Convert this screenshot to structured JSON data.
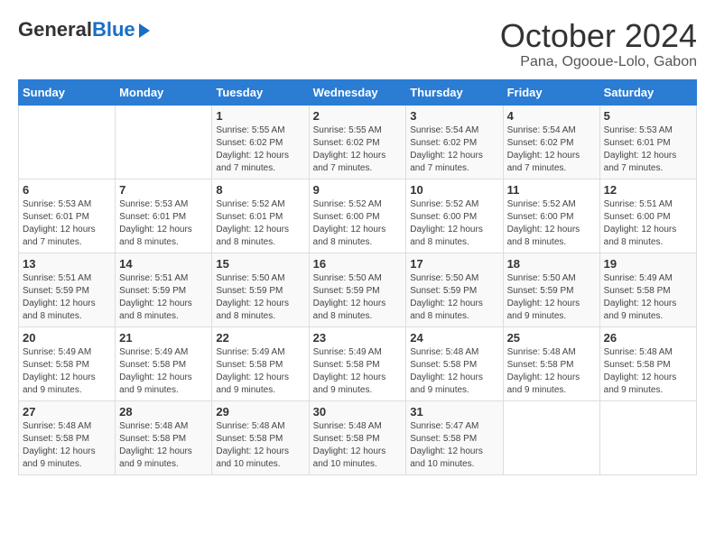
{
  "header": {
    "logo_general": "General",
    "logo_blue": "Blue",
    "title": "October 2024",
    "subtitle": "Pana, Ogooue-Lolo, Gabon"
  },
  "columns": [
    "Sunday",
    "Monday",
    "Tuesday",
    "Wednesday",
    "Thursday",
    "Friday",
    "Saturday"
  ],
  "weeks": [
    [
      {
        "day": "",
        "sunrise": "",
        "sunset": "",
        "daylight": ""
      },
      {
        "day": "",
        "sunrise": "",
        "sunset": "",
        "daylight": ""
      },
      {
        "day": "1",
        "sunrise": "Sunrise: 5:55 AM",
        "sunset": "Sunset: 6:02 PM",
        "daylight": "Daylight: 12 hours and 7 minutes."
      },
      {
        "day": "2",
        "sunrise": "Sunrise: 5:55 AM",
        "sunset": "Sunset: 6:02 PM",
        "daylight": "Daylight: 12 hours and 7 minutes."
      },
      {
        "day": "3",
        "sunrise": "Sunrise: 5:54 AM",
        "sunset": "Sunset: 6:02 PM",
        "daylight": "Daylight: 12 hours and 7 minutes."
      },
      {
        "day": "4",
        "sunrise": "Sunrise: 5:54 AM",
        "sunset": "Sunset: 6:02 PM",
        "daylight": "Daylight: 12 hours and 7 minutes."
      },
      {
        "day": "5",
        "sunrise": "Sunrise: 5:53 AM",
        "sunset": "Sunset: 6:01 PM",
        "daylight": "Daylight: 12 hours and 7 minutes."
      }
    ],
    [
      {
        "day": "6",
        "sunrise": "Sunrise: 5:53 AM",
        "sunset": "Sunset: 6:01 PM",
        "daylight": "Daylight: 12 hours and 7 minutes."
      },
      {
        "day": "7",
        "sunrise": "Sunrise: 5:53 AM",
        "sunset": "Sunset: 6:01 PM",
        "daylight": "Daylight: 12 hours and 8 minutes."
      },
      {
        "day": "8",
        "sunrise": "Sunrise: 5:52 AM",
        "sunset": "Sunset: 6:01 PM",
        "daylight": "Daylight: 12 hours and 8 minutes."
      },
      {
        "day": "9",
        "sunrise": "Sunrise: 5:52 AM",
        "sunset": "Sunset: 6:00 PM",
        "daylight": "Daylight: 12 hours and 8 minutes."
      },
      {
        "day": "10",
        "sunrise": "Sunrise: 5:52 AM",
        "sunset": "Sunset: 6:00 PM",
        "daylight": "Daylight: 12 hours and 8 minutes."
      },
      {
        "day": "11",
        "sunrise": "Sunrise: 5:52 AM",
        "sunset": "Sunset: 6:00 PM",
        "daylight": "Daylight: 12 hours and 8 minutes."
      },
      {
        "day": "12",
        "sunrise": "Sunrise: 5:51 AM",
        "sunset": "Sunset: 6:00 PM",
        "daylight": "Daylight: 12 hours and 8 minutes."
      }
    ],
    [
      {
        "day": "13",
        "sunrise": "Sunrise: 5:51 AM",
        "sunset": "Sunset: 5:59 PM",
        "daylight": "Daylight: 12 hours and 8 minutes."
      },
      {
        "day": "14",
        "sunrise": "Sunrise: 5:51 AM",
        "sunset": "Sunset: 5:59 PM",
        "daylight": "Daylight: 12 hours and 8 minutes."
      },
      {
        "day": "15",
        "sunrise": "Sunrise: 5:50 AM",
        "sunset": "Sunset: 5:59 PM",
        "daylight": "Daylight: 12 hours and 8 minutes."
      },
      {
        "day": "16",
        "sunrise": "Sunrise: 5:50 AM",
        "sunset": "Sunset: 5:59 PM",
        "daylight": "Daylight: 12 hours and 8 minutes."
      },
      {
        "day": "17",
        "sunrise": "Sunrise: 5:50 AM",
        "sunset": "Sunset: 5:59 PM",
        "daylight": "Daylight: 12 hours and 8 minutes."
      },
      {
        "day": "18",
        "sunrise": "Sunrise: 5:50 AM",
        "sunset": "Sunset: 5:59 PM",
        "daylight": "Daylight: 12 hours and 9 minutes."
      },
      {
        "day": "19",
        "sunrise": "Sunrise: 5:49 AM",
        "sunset": "Sunset: 5:58 PM",
        "daylight": "Daylight: 12 hours and 9 minutes."
      }
    ],
    [
      {
        "day": "20",
        "sunrise": "Sunrise: 5:49 AM",
        "sunset": "Sunset: 5:58 PM",
        "daylight": "Daylight: 12 hours and 9 minutes."
      },
      {
        "day": "21",
        "sunrise": "Sunrise: 5:49 AM",
        "sunset": "Sunset: 5:58 PM",
        "daylight": "Daylight: 12 hours and 9 minutes."
      },
      {
        "day": "22",
        "sunrise": "Sunrise: 5:49 AM",
        "sunset": "Sunset: 5:58 PM",
        "daylight": "Daylight: 12 hours and 9 minutes."
      },
      {
        "day": "23",
        "sunrise": "Sunrise: 5:49 AM",
        "sunset": "Sunset: 5:58 PM",
        "daylight": "Daylight: 12 hours and 9 minutes."
      },
      {
        "day": "24",
        "sunrise": "Sunrise: 5:48 AM",
        "sunset": "Sunset: 5:58 PM",
        "daylight": "Daylight: 12 hours and 9 minutes."
      },
      {
        "day": "25",
        "sunrise": "Sunrise: 5:48 AM",
        "sunset": "Sunset: 5:58 PM",
        "daylight": "Daylight: 12 hours and 9 minutes."
      },
      {
        "day": "26",
        "sunrise": "Sunrise: 5:48 AM",
        "sunset": "Sunset: 5:58 PM",
        "daylight": "Daylight: 12 hours and 9 minutes."
      }
    ],
    [
      {
        "day": "27",
        "sunrise": "Sunrise: 5:48 AM",
        "sunset": "Sunset: 5:58 PM",
        "daylight": "Daylight: 12 hours and 9 minutes."
      },
      {
        "day": "28",
        "sunrise": "Sunrise: 5:48 AM",
        "sunset": "Sunset: 5:58 PM",
        "daylight": "Daylight: 12 hours and 9 minutes."
      },
      {
        "day": "29",
        "sunrise": "Sunrise: 5:48 AM",
        "sunset": "Sunset: 5:58 PM",
        "daylight": "Daylight: 12 hours and 10 minutes."
      },
      {
        "day": "30",
        "sunrise": "Sunrise: 5:48 AM",
        "sunset": "Sunset: 5:58 PM",
        "daylight": "Daylight: 12 hours and 10 minutes."
      },
      {
        "day": "31",
        "sunrise": "Sunrise: 5:47 AM",
        "sunset": "Sunset: 5:58 PM",
        "daylight": "Daylight: 12 hours and 10 minutes."
      },
      {
        "day": "",
        "sunrise": "",
        "sunset": "",
        "daylight": ""
      },
      {
        "day": "",
        "sunrise": "",
        "sunset": "",
        "daylight": ""
      }
    ]
  ]
}
